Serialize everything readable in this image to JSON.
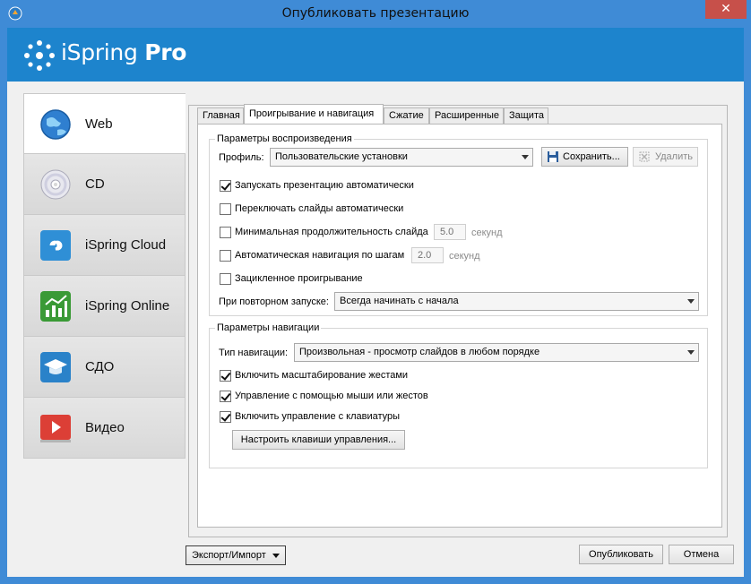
{
  "window": {
    "title": "Опубликовать презентацию",
    "close_glyph": "✕"
  },
  "banner": {
    "brand_light": "iSpring",
    "brand_bold": "Pro"
  },
  "nav": {
    "items": [
      {
        "label": "Web",
        "icon": "globe-icon"
      },
      {
        "label": "CD",
        "icon": "cd-icon"
      },
      {
        "label": "iSpring Cloud",
        "icon": "cloud-icon"
      },
      {
        "label": "iSpring Online",
        "icon": "chart-icon"
      },
      {
        "label": "СДО",
        "icon": "graduation-cap-icon"
      },
      {
        "label": "Видео",
        "icon": "video-play-icon"
      }
    ],
    "active": "Web"
  },
  "tabs": [
    "Главная",
    "Проигрывание и навигация",
    "Сжатие",
    "Расширенные",
    "Защита"
  ],
  "active_tab": "Проигрывание и навигация",
  "playback": {
    "group_title": "Параметры воспроизведения",
    "profile_label": "Профиль:",
    "profile_value": "Пользовательские установки",
    "save_label": "Сохранить...",
    "delete_label": "Удалить",
    "autostart": {
      "label": "Запускать презентацию автоматически",
      "checked": true
    },
    "auto_advance": {
      "label": "Переключать слайды автоматически",
      "checked": false
    },
    "min_duration": {
      "label": "Минимальная продолжительность слайда",
      "checked": false,
      "value": "5.0",
      "unit": "секунд"
    },
    "auto_step": {
      "label": "Автоматическая навигация по шагам",
      "checked": false,
      "value": "2.0",
      "unit": "секунд"
    },
    "loop": {
      "label": "Зацикленное проигрывание",
      "checked": false
    },
    "restart_label": "При повторном запуске:",
    "restart_value": "Всегда начинать с начала"
  },
  "navigation": {
    "group_title": "Параметры навигации",
    "type_label": "Тип навигации:",
    "type_value": "Произвольная -  просмотр слайдов в любом порядке",
    "gesture_zoom": {
      "label": "Включить масштабирование жестами",
      "checked": true
    },
    "mouse_gestures": {
      "label": "Управление с помощью мыши или жестов",
      "checked": true
    },
    "keyboard": {
      "label": "Включить управление с клавиатуры",
      "checked": true
    },
    "keys_button": "Настроить клавиши управления..."
  },
  "footer": {
    "export_import": "Экспорт/Импорт",
    "publish": "Опубликовать",
    "cancel": "Отмена"
  }
}
